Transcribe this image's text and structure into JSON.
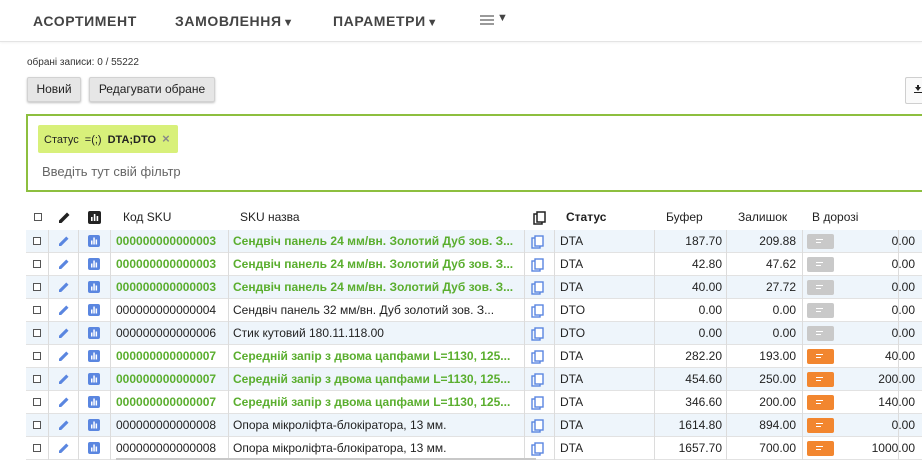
{
  "nav": {
    "items": [
      {
        "label": "АСОРТИМЕНТ",
        "caret": ""
      },
      {
        "label": "ЗАМОВЛЕННЯ",
        "caret": "▼"
      },
      {
        "label": "ПАРАМЕТРИ",
        "caret": "▼"
      }
    ],
    "menu_caret": "▼"
  },
  "selection": {
    "text": "обрані записи: 0 / 55222"
  },
  "buttons": {
    "new": "Новий",
    "edit_selected": "Редагувати обране",
    "download_icon": "download-icon"
  },
  "filter": {
    "chip": {
      "field": "Статус",
      "operator": "=(;)",
      "value": "DTA;DTO",
      "remove": "×"
    },
    "placeholder": "Введіть тут свій фільтр"
  },
  "table": {
    "columns": {
      "sku_code": "Код SKU",
      "sku_name": "SKU назва",
      "status": "Статус",
      "buffer": "Буфер",
      "balance": "Залишок",
      "in_transit": "В дорозі"
    },
    "rows": [
      {
        "sku": "000000000000003",
        "name": "Сендвіч панель 24 мм/вн. Золотий Дуб зов. З...",
        "status": "DTA",
        "buffer": "187.70",
        "balance": "209.88",
        "badge": "grey",
        "transit": "0.00",
        "highlight": true
      },
      {
        "sku": "000000000000003",
        "name": "Сендвіч панель 24 мм/вн. Золотий Дуб зов. З...",
        "status": "DTA",
        "buffer": "42.80",
        "balance": "47.62",
        "badge": "grey",
        "transit": "0.00",
        "highlight": true
      },
      {
        "sku": "000000000000003",
        "name": "Сендвіч панель 24 мм/вн. Золотий Дуб зов. З...",
        "status": "DTA",
        "buffer": "40.00",
        "balance": "27.72",
        "badge": "grey",
        "transit": "0.00",
        "highlight": true
      },
      {
        "sku": "000000000000004",
        "name": "Сендвіч панель 32 мм/вн. Дуб золотий зов. З...",
        "status": "DTO",
        "buffer": "0.00",
        "balance": "0.00",
        "badge": "grey",
        "transit": "0.00",
        "highlight": false
      },
      {
        "sku": "000000000000006",
        "name": "Стик кутовий 180.11.118.00",
        "status": "DTO",
        "buffer": "0.00",
        "balance": "0.00",
        "badge": "grey",
        "transit": "0.00",
        "highlight": false
      },
      {
        "sku": "000000000000007",
        "name": "Середній запір з двома цапфами L=1130, 125...",
        "status": "DTA",
        "buffer": "282.20",
        "balance": "193.00",
        "badge": "orange",
        "transit": "40.00",
        "highlight": true
      },
      {
        "sku": "000000000000007",
        "name": "Середній запір з двома цапфами L=1130, 125...",
        "status": "DTA",
        "buffer": "454.60",
        "balance": "250.00",
        "badge": "orange",
        "transit": "200.00",
        "highlight": true
      },
      {
        "sku": "000000000000007",
        "name": "Середній запір з двома цапфами L=1130, 125...",
        "status": "DTA",
        "buffer": "346.60",
        "balance": "200.00",
        "badge": "orange",
        "transit": "140.00",
        "highlight": true
      },
      {
        "sku": "000000000000008",
        "name": "Опора мікроліфта-блокіратора, 13 мм.",
        "status": "DTA",
        "buffer": "1614.80",
        "balance": "894.00",
        "badge": "orange",
        "transit": "0.00",
        "highlight": false
      },
      {
        "sku": "000000000000008",
        "name": "Опора мікроліфта-блокіратора, 13 мм.",
        "status": "DTA",
        "buffer": "1657.70",
        "balance": "700.00",
        "badge": "orange",
        "transit": "1000.00",
        "highlight": false
      }
    ]
  },
  "colors": {
    "green_text": "#5aae2e",
    "filter_border": "#8dbf3f",
    "chip_bg": "#d8f07a",
    "badge_grey": "#c9c9c9",
    "badge_orange": "#f2862f",
    "icon_blue": "#5a86e0",
    "row_alt": "#eef5fb"
  }
}
